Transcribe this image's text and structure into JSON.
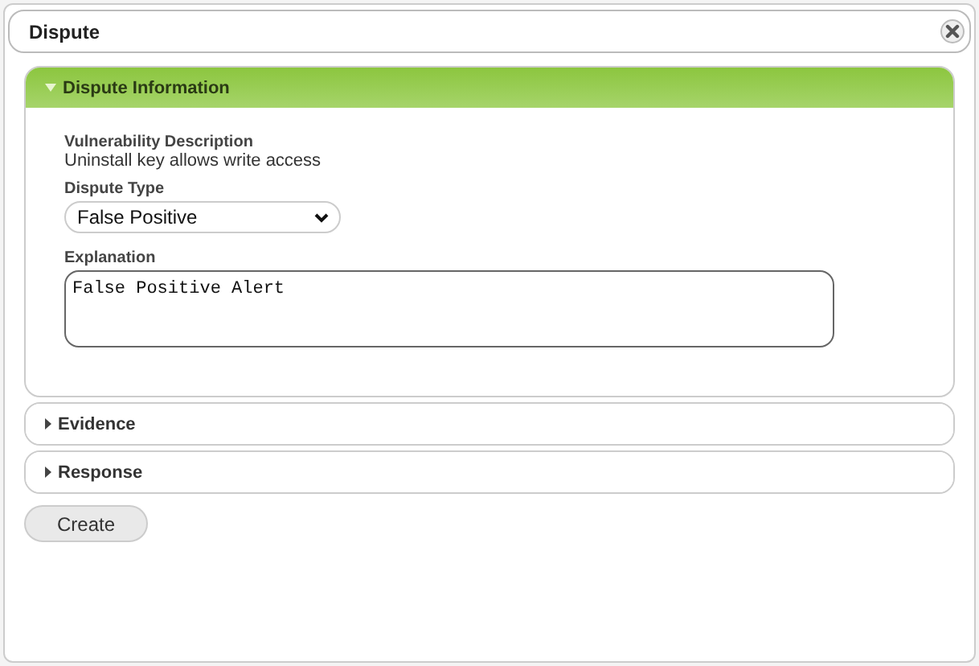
{
  "window": {
    "title": "Dispute"
  },
  "sections": [
    {
      "title": "Dispute Information",
      "expanded": true,
      "fields": [
        {
          "kind": "text",
          "label": "Vulnerability Description",
          "value": "Uninstall key allows write access"
        },
        {
          "kind": "select",
          "label": "Dispute Type",
          "value": "False Positive"
        },
        {
          "kind": "textarea",
          "label": "Explanation",
          "value": "False Positive Alert"
        }
      ]
    },
    {
      "title": "Evidence",
      "expanded": false
    },
    {
      "title": "Response",
      "expanded": false
    }
  ],
  "buttons": [
    "Create"
  ]
}
